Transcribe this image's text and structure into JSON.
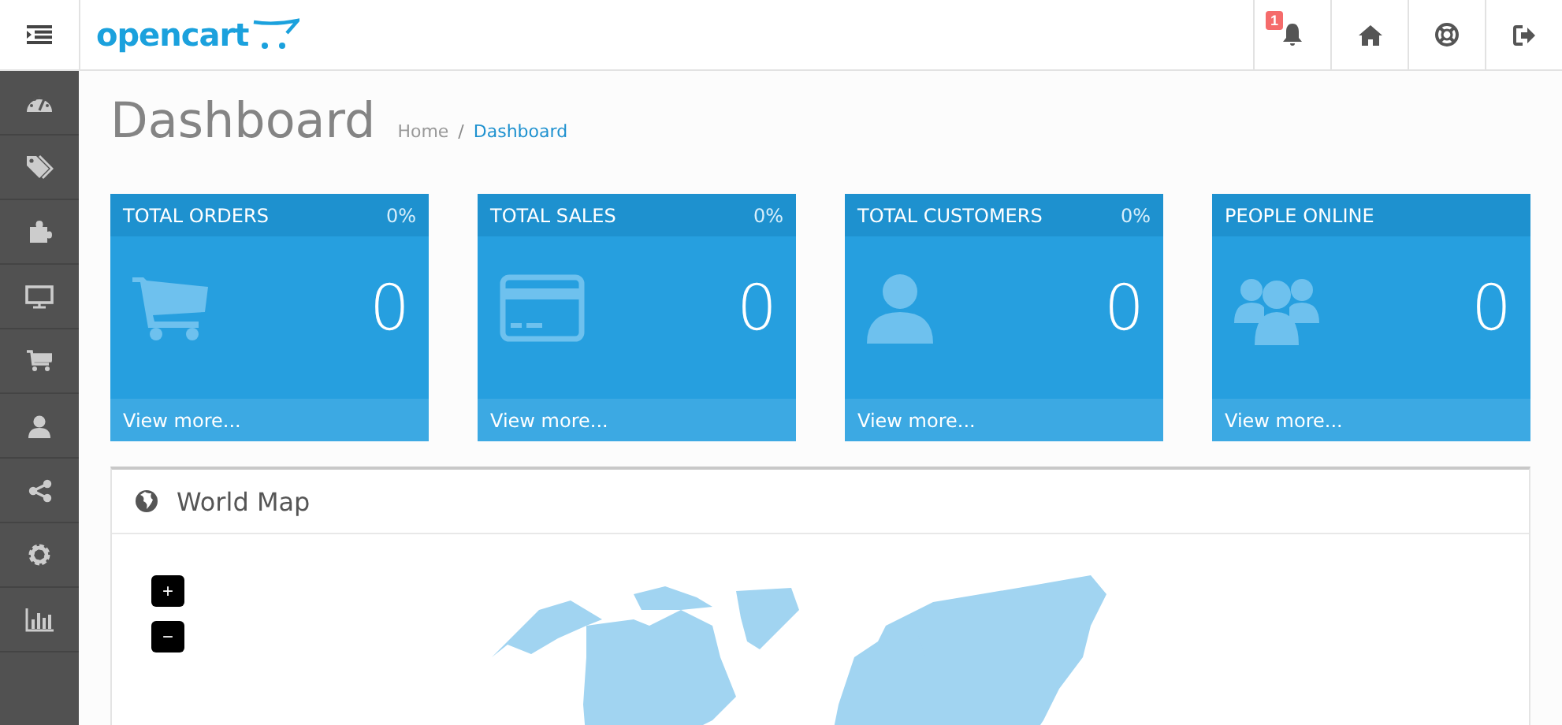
{
  "header": {
    "logo": "opencart",
    "notifications": {
      "count": "1"
    }
  },
  "sidebar": {
    "items": [
      {
        "kind": "dashboard"
      },
      {
        "kind": "catalog"
      },
      {
        "kind": "extensions"
      },
      {
        "kind": "design"
      },
      {
        "kind": "sales"
      },
      {
        "kind": "customers"
      },
      {
        "kind": "marketing"
      },
      {
        "kind": "system"
      },
      {
        "kind": "reports"
      }
    ]
  },
  "page": {
    "title": "Dashboard",
    "breadcrumb_separator": "/",
    "breadcrumb": [
      {
        "label": "Home",
        "selected": false
      },
      {
        "label": "Dashboard",
        "selected": true
      }
    ]
  },
  "tiles": [
    {
      "kind": "orders",
      "title": "TOTAL ORDERS",
      "percent": "0%",
      "value": "0",
      "link": "View more..."
    },
    {
      "kind": "sales",
      "title": "TOTAL SALES",
      "percent": "0%",
      "value": "0",
      "link": "View more..."
    },
    {
      "kind": "customers",
      "title": "TOTAL CUSTOMERS",
      "percent": "0%",
      "value": "0",
      "link": "View more..."
    },
    {
      "kind": "online",
      "title": "PEOPLE ONLINE",
      "value": "0",
      "link": "View more..."
    }
  ],
  "world_map": {
    "title": "World Map",
    "zoom_in": "+",
    "zoom_out": "−"
  }
}
